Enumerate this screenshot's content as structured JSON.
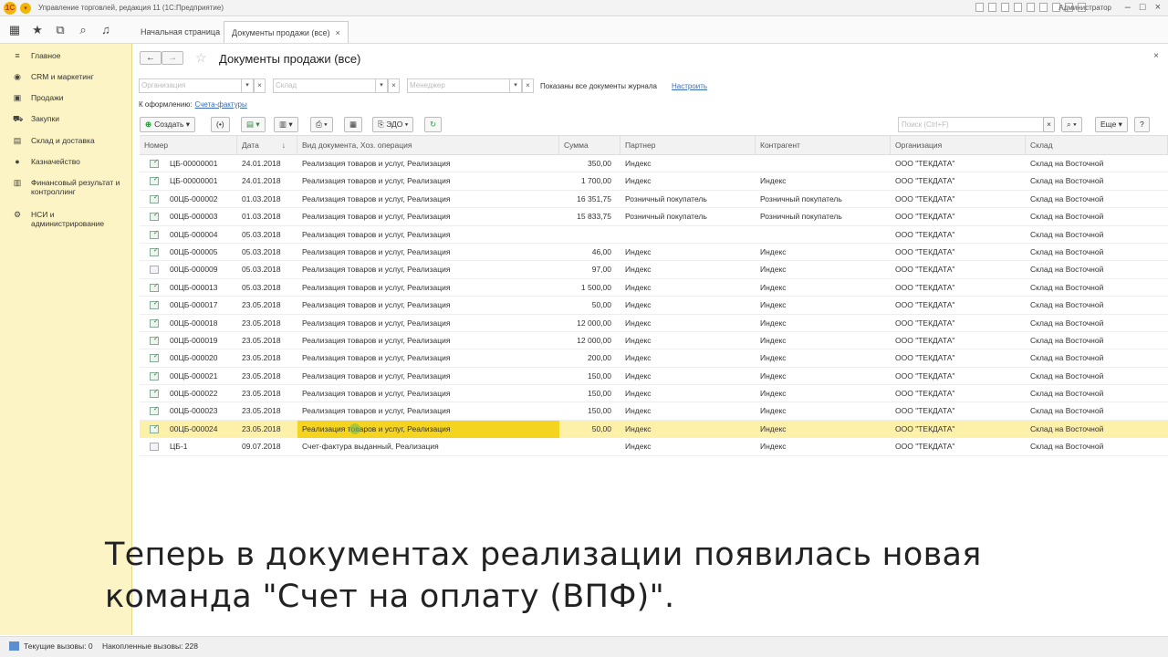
{
  "window": {
    "title": "Управление торговлей, редакция 11 (1С:Предприятие)",
    "user": "Администратор",
    "logo_text": "1С"
  },
  "tabs": [
    {
      "label": "Начальная страница"
    },
    {
      "label": "Документы продажи (все)",
      "close": "×"
    }
  ],
  "sidebar": {
    "items": [
      {
        "label": "Главное"
      },
      {
        "label": "CRM и маркетинг"
      },
      {
        "label": "Продажи"
      },
      {
        "label": "Закупки"
      },
      {
        "label": "Склад и доставка"
      },
      {
        "label": "Казначейство"
      },
      {
        "label": "Финансовый результат и контроллинг"
      },
      {
        "label": "НСИ и администрирование"
      }
    ]
  },
  "form": {
    "title": "Документы продажи (все)",
    "close": "×",
    "filters": {
      "org_placeholder": "Организация",
      "warehouse_placeholder": "Склад",
      "manager_placeholder": "Менеджер",
      "clear": "×",
      "dropdown": "▾",
      "shown_text": "Показаны все документы журнала",
      "setup_link": "Настроить"
    },
    "to_process_label": "К оформлению:",
    "to_process_link": "Счета-фактуры",
    "toolbar": {
      "create": "Создать",
      "edo": "ЭДО",
      "search_placeholder": "Поиск (Ctrl+F)",
      "more": "Еще",
      "help": "?"
    }
  },
  "table": {
    "columns": [
      "Номер",
      "Дата",
      "Вид документа, Хоз. операция",
      "Сумма",
      "Партнер",
      "Контрагент",
      "Организация",
      "Склад"
    ],
    "sort_indicator": "↓",
    "rows": [
      {
        "num": "ЦБ-00000001",
        "date": "24.01.2018",
        "type": "Реализация товаров и услуг, Реализация",
        "sum": "350,00",
        "partner": "Индекс",
        "contractor": "",
        "org": "ООО \"ТЕКДАТА\"",
        "wh": "Склад на Восточной",
        "posted": true
      },
      {
        "num": "ЦБ-00000001",
        "date": "24.01.2018",
        "type": "Реализация товаров и услуг, Реализация",
        "sum": "1 700,00",
        "partner": "Индекс",
        "contractor": "Индекс",
        "org": "ООО \"ТЕКДАТА\"",
        "wh": "Склад на Восточной",
        "posted": true
      },
      {
        "num": "00ЦБ-000002",
        "date": "01.03.2018",
        "type": "Реализация товаров и услуг, Реализация",
        "sum": "16 351,75",
        "partner": "Розничный покупатель",
        "contractor": "Розничный покупатель",
        "org": "ООО \"ТЕКДАТА\"",
        "wh": "Склад на Восточной",
        "posted": true
      },
      {
        "num": "00ЦБ-000003",
        "date": "01.03.2018",
        "type": "Реализация товаров и услуг, Реализация",
        "sum": "15 833,75",
        "partner": "Розничный покупатель",
        "contractor": "Розничный покупатель",
        "org": "ООО \"ТЕКДАТА\"",
        "wh": "Склад на Восточной",
        "posted": true
      },
      {
        "num": "00ЦБ-000004",
        "date": "05.03.2018",
        "type": "Реализация товаров и услуг, Реализация",
        "sum": "",
        "partner": "",
        "contractor": "",
        "org": "ООО \"ТЕКДАТА\"",
        "wh": "Склад на Восточной",
        "posted": true
      },
      {
        "num": "00ЦБ-000005",
        "date": "05.03.2018",
        "type": "Реализация товаров и услуг, Реализация",
        "sum": "46,00",
        "partner": "Индекс",
        "contractor": "Индекс",
        "org": "ООО \"ТЕКДАТА\"",
        "wh": "Склад на Восточной",
        "posted": true
      },
      {
        "num": "00ЦБ-000009",
        "date": "05.03.2018",
        "type": "Реализация товаров и услуг, Реализация",
        "sum": "97,00",
        "partner": "Индекс",
        "contractor": "Индекс",
        "org": "ООО \"ТЕКДАТА\"",
        "wh": "Склад на Восточной",
        "posted": false
      },
      {
        "num": "00ЦБ-000013",
        "date": "05.03.2018",
        "type": "Реализация товаров и услуг, Реализация",
        "sum": "1 500,00",
        "partner": "Индекс",
        "contractor": "Индекс",
        "org": "ООО \"ТЕКДАТА\"",
        "wh": "Склад на Восточной",
        "posted": true
      },
      {
        "num": "00ЦБ-000017",
        "date": "23.05.2018",
        "type": "Реализация товаров и услуг, Реализация",
        "sum": "50,00",
        "partner": "Индекс",
        "contractor": "Индекс",
        "org": "ООО \"ТЕКДАТА\"",
        "wh": "Склад на Восточной",
        "posted": true
      },
      {
        "num": "00ЦБ-000018",
        "date": "23.05.2018",
        "type": "Реализация товаров и услуг, Реализация",
        "sum": "12 000,00",
        "partner": "Индекс",
        "contractor": "Индекс",
        "org": "ООО \"ТЕКДАТА\"",
        "wh": "Склад на Восточной",
        "posted": true
      },
      {
        "num": "00ЦБ-000019",
        "date": "23.05.2018",
        "type": "Реализация товаров и услуг, Реализация",
        "sum": "12 000,00",
        "partner": "Индекс",
        "contractor": "Индекс",
        "org": "ООО \"ТЕКДАТА\"",
        "wh": "Склад на Восточной",
        "posted": true
      },
      {
        "num": "00ЦБ-000020",
        "date": "23.05.2018",
        "type": "Реализация товаров и услуг, Реализация",
        "sum": "200,00",
        "partner": "Индекс",
        "contractor": "Индекс",
        "org": "ООО \"ТЕКДАТА\"",
        "wh": "Склад на Восточной",
        "posted": true
      },
      {
        "num": "00ЦБ-000021",
        "date": "23.05.2018",
        "type": "Реализация товаров и услуг, Реализация",
        "sum": "150,00",
        "partner": "Индекс",
        "contractor": "Индекс",
        "org": "ООО \"ТЕКДАТА\"",
        "wh": "Склад на Восточной",
        "posted": true
      },
      {
        "num": "00ЦБ-000022",
        "date": "23.05.2018",
        "type": "Реализация товаров и услуг, Реализация",
        "sum": "150,00",
        "partner": "Индекс",
        "contractor": "Индекс",
        "org": "ООО \"ТЕКДАТА\"",
        "wh": "Склад на Восточной",
        "posted": true
      },
      {
        "num": "00ЦБ-000023",
        "date": "23.05.2018",
        "type": "Реализация товаров и услуг, Реализация",
        "sum": "150,00",
        "partner": "Индекс",
        "contractor": "Индекс",
        "org": "ООО \"ТЕКДАТА\"",
        "wh": "Склад на Восточной",
        "posted": true
      },
      {
        "num": "00ЦБ-000024",
        "date": "23.05.2018",
        "type": "Реализация товаров и услуг, Реализация",
        "sum": "50,00",
        "partner": "Индекс",
        "contractor": "Индекс",
        "org": "ООО \"ТЕКДАТА\"",
        "wh": "Склад на Восточной",
        "posted": true,
        "selected": true
      },
      {
        "num": "ЦБ-1",
        "date": "09.07.2018",
        "type": "Счет-фактура выданный, Реализация",
        "sum": "",
        "partner": "Индекс",
        "contractor": "Индекс",
        "org": "ООО \"ТЕКДАТА\"",
        "wh": "Склад на Восточной",
        "posted": false
      }
    ]
  },
  "subtitle": "Теперь в документах реализации появилась новая команда \"Счет на оплату (ВПФ)\".",
  "statusbar": {
    "current_calls": "Текущие вызовы: 0",
    "accumulated_calls": "Накопленные вызовы: 228"
  },
  "colors": {
    "sidebar_bg": "#fcf4c4",
    "selected_row": "#fdf0a8",
    "selected_cell": "#f5d41f",
    "link": "#3b6db5"
  }
}
